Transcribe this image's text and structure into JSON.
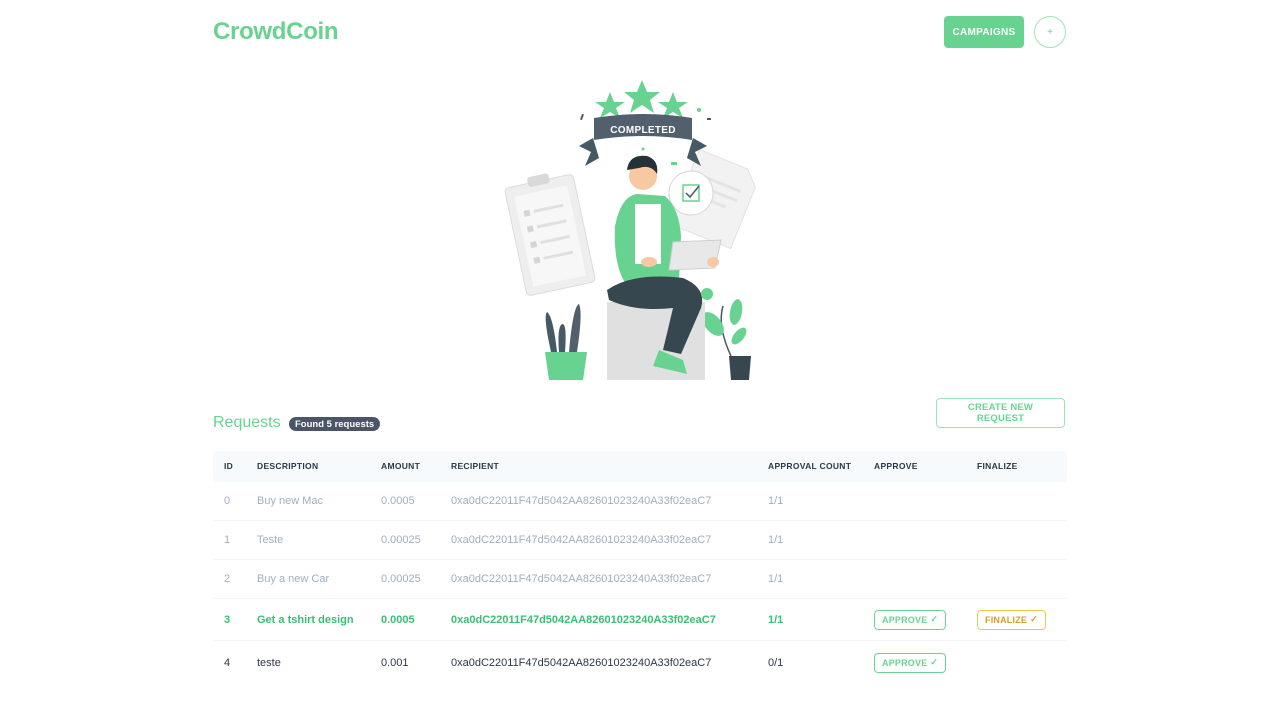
{
  "header": {
    "logo": "CrowdCoin",
    "campaigns_label": "CAMPAIGNS",
    "circle_label": "+"
  },
  "illustration": {
    "banner_text": "COMPLETED"
  },
  "requests": {
    "title": "Requests",
    "badge": "Found 5 requests",
    "create_label": "CREATE NEW REQUEST",
    "columns": [
      "ID",
      "DESCRIPTION",
      "AMOUNT",
      "RECIPIENT",
      "APPROVAL COUNT",
      "APPROVE",
      "FINALIZE"
    ],
    "rows": [
      {
        "id": "0",
        "description": "Buy new Mac",
        "amount": "0.0005",
        "recipient": "0xa0dC22011F47d5042AA82601023240A33f02eaC7",
        "approval_count": "1/1",
        "status": "done"
      },
      {
        "id": "1",
        "description": "Teste",
        "amount": "0.00025",
        "recipient": "0xa0dC22011F47d5042AA82601023240A33f02eaC7",
        "approval_count": "1/1",
        "status": "done"
      },
      {
        "id": "2",
        "description": "Buy a new Car",
        "amount": "0.00025",
        "recipient": "0xa0dC22011F47d5042AA82601023240A33f02eaC7",
        "approval_count": "1/1",
        "status": "done"
      },
      {
        "id": "3",
        "description": "Get a tshirt design",
        "amount": "0.0005",
        "recipient": "0xa0dC22011F47d5042AA82601023240A33f02eaC7",
        "approval_count": "1/1",
        "status": "ready",
        "approve_label": "APPROVE",
        "finalize_label": "FINALIZE"
      },
      {
        "id": "4",
        "description": "teste",
        "amount": "0.001",
        "recipient": "0xa0dC22011F47d5042AA82601023240A33f02eaC7",
        "approval_count": "0/1",
        "status": "pending",
        "approve_label": "APPROVE"
      }
    ]
  },
  "colors": {
    "brand": "#68d391",
    "ready_row": "#38c172",
    "finalize": "#d69e2e",
    "badge_bg": "#4a5568",
    "muted": "#a0aec0"
  },
  "icons": [
    "check-icon",
    "plus-icon",
    "star-icon",
    "checkbox-icon"
  ]
}
